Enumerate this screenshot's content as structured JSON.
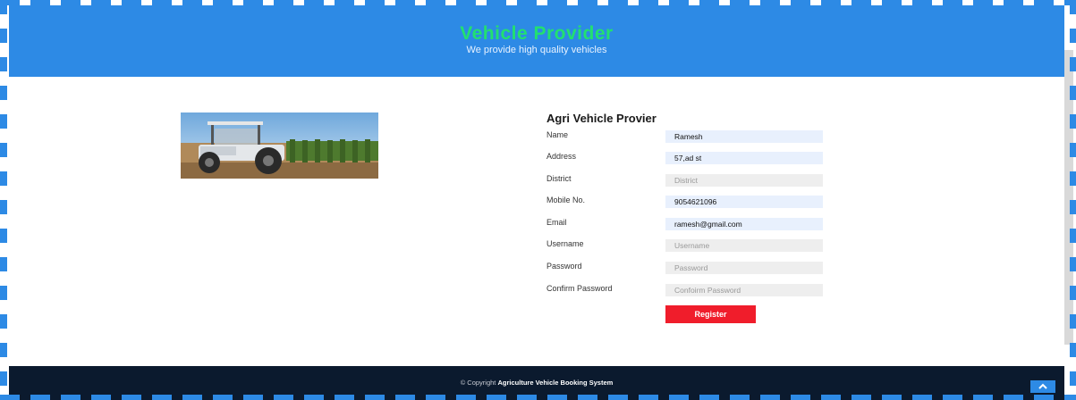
{
  "header": {
    "title": "Vehicle Provider",
    "tagline": "We provide high quality vehicles"
  },
  "form": {
    "title": "Agri Vehicle Provier",
    "fields": [
      {
        "label": "Name",
        "value": "Ramesh",
        "placeholder": ""
      },
      {
        "label": "Address",
        "value": "57,ad st",
        "placeholder": ""
      },
      {
        "label": "District",
        "value": "",
        "placeholder": "District"
      },
      {
        "label": "Mobile No.",
        "value": "9054621096",
        "placeholder": ""
      },
      {
        "label": "Email",
        "value": "ramesh@gmail.com",
        "placeholder": ""
      },
      {
        "label": "Username",
        "value": "",
        "placeholder": "Username"
      },
      {
        "label": "Password",
        "value": "",
        "placeholder": "Password"
      },
      {
        "label": "Confirm Password",
        "value": "",
        "placeholder": "Confoirm Password"
      }
    ],
    "submit_label": "Register"
  },
  "footer": {
    "copyright_prefix": "© Copyright",
    "copyright_name": "Agriculture Vehicle Booking System"
  },
  "icons": {
    "back_to_top": "chevron-up-icon"
  },
  "colors": {
    "header_bg": "#2d8ae5",
    "title_green": "#22e070",
    "register_red": "#f01d2b",
    "footer_bg": "#0b1a2e"
  }
}
